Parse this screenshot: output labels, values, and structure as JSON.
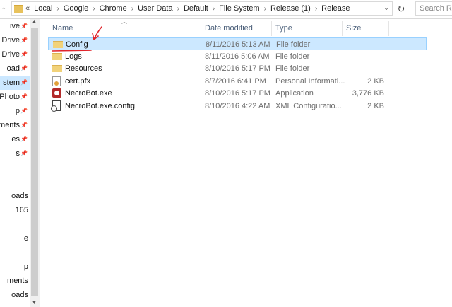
{
  "address": {
    "overflow": "«",
    "crumbs": [
      "Local",
      "Google",
      "Chrome",
      "User Data",
      "Default",
      "File System",
      "Release (1)",
      "Release"
    ],
    "separator": "›",
    "dropdown": "⌄"
  },
  "search": {
    "placeholder": "Search Release"
  },
  "nav": {
    "items": [
      {
        "label": "ive",
        "pinned": true
      },
      {
        "label": "Drive",
        "pinned": true
      },
      {
        "label": "e Drive",
        "pinned": true
      },
      {
        "label": "oad",
        "pinned": true
      },
      {
        "label": "stem",
        "pinned": true,
        "selected": true
      },
      {
        "label": "Photo",
        "pinned": true
      },
      {
        "label": "p",
        "pinned": true
      },
      {
        "label": "ments",
        "pinned": true
      },
      {
        "label": "es",
        "pinned": true
      },
      {
        "label": "s",
        "pinned": true
      },
      {
        "label": "",
        "pinned": false
      },
      {
        "label": "",
        "pinned": false
      },
      {
        "label": "oads",
        "pinned": false
      },
      {
        "label": "165",
        "pinned": false
      },
      {
        "label": "",
        "pinned": false
      },
      {
        "label": "e",
        "pinned": false
      },
      {
        "label": "",
        "pinned": false
      },
      {
        "label": "p",
        "pinned": false
      },
      {
        "label": "ments",
        "pinned": false
      },
      {
        "label": "oads",
        "pinned": false
      }
    ]
  },
  "columns": {
    "name": "Name",
    "date": "Date modified",
    "type": "Type",
    "size": "Size"
  },
  "files": [
    {
      "icon": "folder-icon",
      "name": "Config",
      "date": "8/11/2016 5:13 AM",
      "type": "File folder",
      "size": "",
      "selected": true
    },
    {
      "icon": "folder-icon",
      "name": "Logs",
      "date": "8/11/2016 5:06 AM",
      "type": "File folder",
      "size": ""
    },
    {
      "icon": "folder-icon",
      "name": "Resources",
      "date": "8/10/2016 5:17 PM",
      "type": "File folder",
      "size": ""
    },
    {
      "icon": "certificate-icon",
      "name": "cert.pfx",
      "date": "8/7/2016 6:41 PM",
      "type": "Personal Informati...",
      "size": "2 KB"
    },
    {
      "icon": "exe-icon",
      "name": "NecroBot.exe",
      "date": "8/10/2016 5:17 PM",
      "type": "Application",
      "size": "3,776 KB"
    },
    {
      "icon": "config-file-icon",
      "name": "NecroBot.exe.config",
      "date": "8/10/2016 4:22 AM",
      "type": "XML Configuratio...",
      "size": "2 KB"
    }
  ],
  "colors": {
    "selection": "#cce8ff",
    "selection_border": "#99d1ff",
    "annotation": "#e0252b",
    "header_text": "#4c607a"
  }
}
